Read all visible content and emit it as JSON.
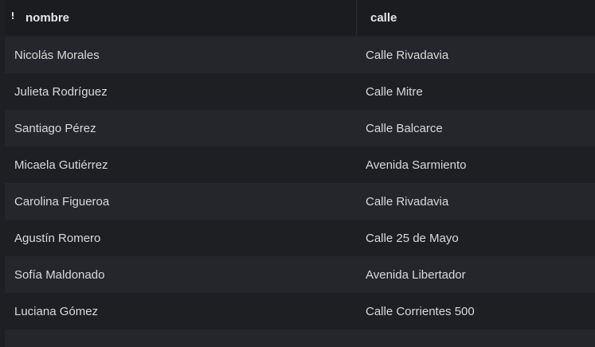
{
  "table": {
    "columns": {
      "nombre": "nombre",
      "calle": "calle"
    },
    "rows": [
      {
        "nombre": "Nicolás Morales",
        "calle": "Calle Rivadavia"
      },
      {
        "nombre": "Julieta Rodríguez",
        "calle": "Calle Mitre"
      },
      {
        "nombre": "Santiago Pérez",
        "calle": "Calle Balcarce"
      },
      {
        "nombre": "Micaela Gutiérrez",
        "calle": "Avenida Sarmiento"
      },
      {
        "nombre": "Carolina Figueroa",
        "calle": "Calle Rivadavia"
      },
      {
        "nombre": "Agustín Romero",
        "calle": "Calle 25 de Mayo"
      },
      {
        "nombre": "Sofía Maldonado",
        "calle": "Avenida Libertador"
      },
      {
        "nombre": "Luciana Gómez",
        "calle": "Calle Corrientes 500"
      }
    ],
    "sort_icon": "sort-indicator-icon",
    "colors": {
      "background": "#1e1f23",
      "row_alt": "#25262b",
      "header_bg": "#1b1c20",
      "text": "#d9d9d9",
      "header_text": "#e6e6e6"
    }
  }
}
